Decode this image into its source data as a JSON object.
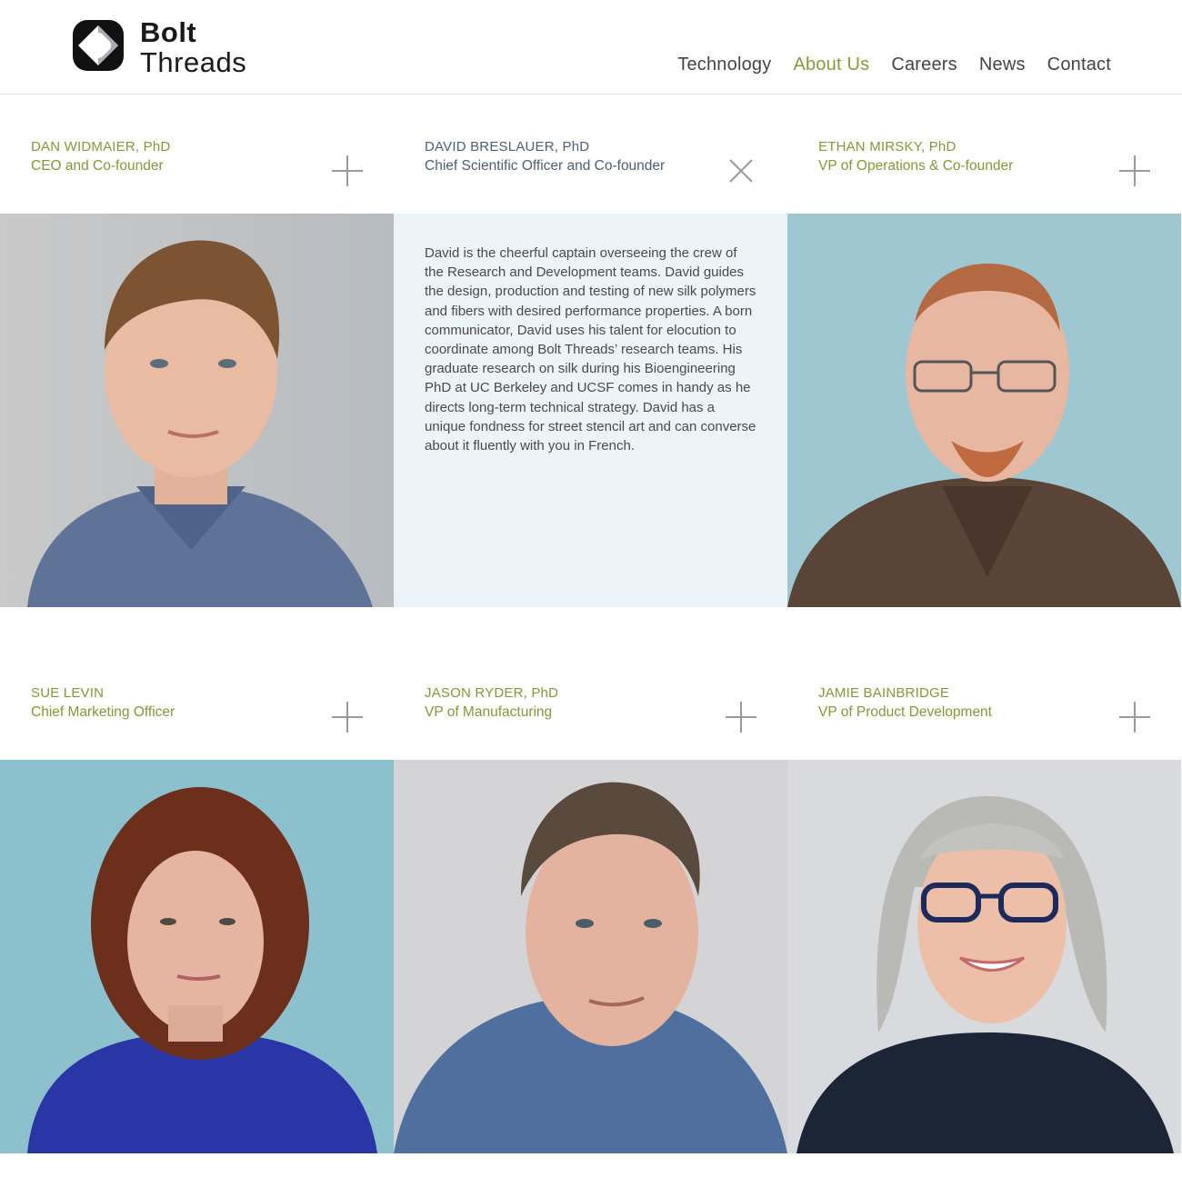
{
  "brand": {
    "logo_line1": "Bolt",
    "logo_line2": "Threads"
  },
  "nav": {
    "items": [
      {
        "label": "Technology",
        "active": false
      },
      {
        "label": "About Us",
        "active": true
      },
      {
        "label": "Careers",
        "active": false
      },
      {
        "label": "News",
        "active": false
      },
      {
        "label": "Contact",
        "active": false
      }
    ]
  },
  "colors": {
    "accent": "#8a9a3a",
    "open_title": "#4e5e74",
    "bio_bg": "#ecf4fa"
  },
  "team": [
    {
      "name": "DAN WIDMAIER, PhD",
      "role": "CEO and Co-founder",
      "toggle_icon": "plus-icon"
    },
    {
      "name": "DAVID BRESLAUER, PhD",
      "role": "Chief Scientific Officer and Co-founder",
      "toggle_icon": "close-icon",
      "bio": "David is the cheerful captain overseeing the crew of the Research and Development teams. David guides the design, production and testing of new silk polymers and fibers with desired performance properties. A born communicator, David uses his talent for elocution to coordinate among Bolt Threads’ research teams. His graduate research on silk during his Bioengineering PhD at UC Berkeley and UCSF comes in handy as he directs long-term technical strategy. David has a unique fondness for street stencil art and can converse about it fluently with you in French."
    },
    {
      "name": "ETHAN MIRSKY, PhD",
      "role": "VP of Operations & Co-founder",
      "toggle_icon": "plus-icon"
    },
    {
      "name": "SUE LEVIN",
      "role": "Chief Marketing Officer",
      "toggle_icon": "plus-icon"
    },
    {
      "name": "JASON RYDER, PhD",
      "role": "VP of Manufacturing",
      "toggle_icon": "plus-icon"
    },
    {
      "name": "JAMIE BAINBRIDGE",
      "role": "VP of Product Development",
      "toggle_icon": "plus-icon"
    }
  ]
}
